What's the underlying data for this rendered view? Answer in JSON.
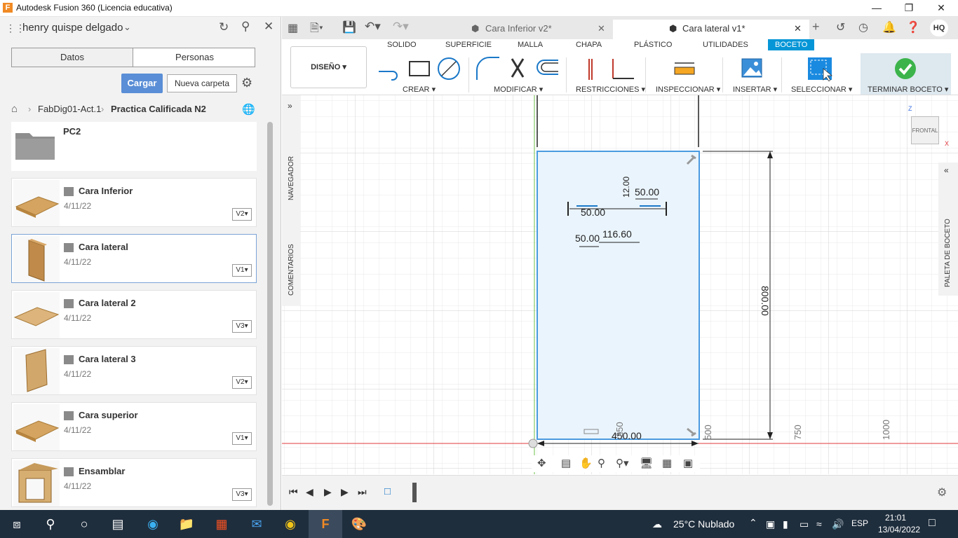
{
  "window": {
    "title": "Autodesk Fusion 360 (Licencia educativa)",
    "app_icon_letter": "F"
  },
  "data_panel": {
    "user": "henry quispe delgado",
    "tabs": [
      "Datos",
      "Personas"
    ],
    "upload_label": "Cargar",
    "new_folder_label": "Nueva carpeta",
    "breadcrumb": [
      "FabDig01-Act.1",
      "Practica Calificada N2"
    ],
    "folder": {
      "name": "PC2"
    },
    "files": [
      {
        "name": "Cara Inferior",
        "date": "4/11/22",
        "version": "V2"
      },
      {
        "name": "Cara lateral",
        "date": "4/11/22",
        "version": "V1"
      },
      {
        "name": "Cara lateral 2",
        "date": "4/11/22",
        "version": "V3"
      },
      {
        "name": "Cara lateral 3",
        "date": "4/11/22",
        "version": "V2"
      },
      {
        "name": "Cara superior",
        "date": "4/11/22",
        "version": "V1"
      },
      {
        "name": "Ensamblar",
        "date": "4/11/22",
        "version": "V3"
      }
    ]
  },
  "doc_tabs": [
    {
      "label": "Cara Inferior v2*"
    },
    {
      "label": "Cara lateral v1*"
    }
  ],
  "user_initials": "HQ",
  "ribbon": {
    "workspace": "DISEÑO",
    "tabs": [
      "SOLIDO",
      "SUPERFICIE",
      "MALLA",
      "CHAPA",
      "PLÁSTICO",
      "UTILIDADES",
      "BOCETO"
    ],
    "groups": [
      "CREAR",
      "MODIFICAR",
      "RESTRICCIONES",
      "INSPECCIONAR",
      "INSERTAR",
      "SELECCIONAR",
      "TERMINAR BOCETO"
    ]
  },
  "side_labels": {
    "browser": "NAVEGADOR",
    "comments": "COMENTARIOS",
    "sketch_palette": "PALETA DE BOCETO"
  },
  "viewcube": {
    "face": "FRONTAL",
    "z": "Z",
    "x": "X"
  },
  "sketch": {
    "dims": {
      "width": "450.00",
      "height": "800.00",
      "d1": "50.00",
      "d2": "116.60",
      "d3": "50.00",
      "d4": "12.00",
      "d5": "50.00"
    },
    "ruler": [
      "250",
      "500",
      "750",
      "1000"
    ]
  },
  "taskbar": {
    "weather": "25°C  Nublado",
    "lang": "ESP",
    "time": "21:01",
    "date": "13/04/2022"
  },
  "colors": {
    "accent": "#0696d7",
    "upload": "#5a8ed6",
    "sketch_fill": "#eaf4fc",
    "axis_red": "#e0383e"
  }
}
